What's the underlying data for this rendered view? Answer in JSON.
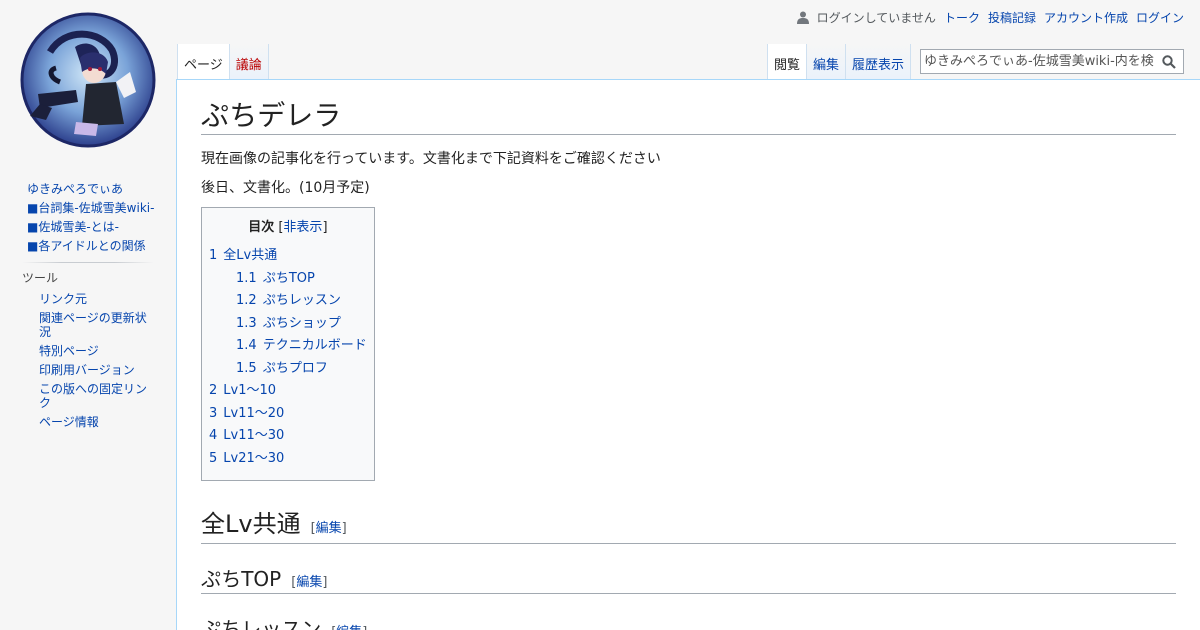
{
  "personal": {
    "anon_label": "ログインしていません",
    "talk": "トーク",
    "contributions": "投稿記録",
    "create_account": "アカウント作成",
    "login": "ログイン"
  },
  "sidebar": {
    "nav": [
      "ゆきみぺろでぃあ",
      "■台詞集-佐城雪美wiki-",
      "■佐城雪美-とは-",
      "■各アイドルとの関係"
    ],
    "tools_heading": "ツール",
    "tools": [
      "リンク元",
      "関連ページの更新状況",
      "特別ページ",
      "印刷用バージョン",
      "この版への固定リンク",
      "ページ情報"
    ]
  },
  "tabs": {
    "page": "ページ",
    "discussion": "議論",
    "read": "閲覧",
    "edit": "編集",
    "history": "履歴表示"
  },
  "search": {
    "placeholder": "ゆきみぺろでぃあ-佐城雪美wiki-内を検"
  },
  "article": {
    "title": "ぷちデレラ",
    "para1": "現在画像の記事化を行っています。文書化まで下記資料をご確認ください",
    "para2": "後日、文書化。(10月予定)"
  },
  "toc": {
    "title": "目次",
    "toggle_open": "[",
    "toggle": "非表示",
    "toggle_close": "]",
    "items": [
      {
        "num": "1",
        "text": "全Lv共通",
        "sub": false
      },
      {
        "num": "1.1",
        "text": "ぷちTOP",
        "sub": true
      },
      {
        "num": "1.2",
        "text": "ぷちレッスン",
        "sub": true
      },
      {
        "num": "1.3",
        "text": "ぷちショップ",
        "sub": true
      },
      {
        "num": "1.4",
        "text": "テクニカルボード",
        "sub": true
      },
      {
        "num": "1.5",
        "text": "ぷちプロフ",
        "sub": true
      },
      {
        "num": "2",
        "text": "Lv1～10",
        "sub": false
      },
      {
        "num": "3",
        "text": "Lv11～20",
        "sub": false
      },
      {
        "num": "4",
        "text": "Lv11～30",
        "sub": false
      },
      {
        "num": "5",
        "text": "Lv21～30",
        "sub": false
      }
    ]
  },
  "sections": {
    "s1": "全Lv共通",
    "s1_1": "ぷちTOP",
    "s1_2": "ぷちレッスン",
    "edit_open": "[",
    "edit_label": "編集",
    "edit_close": "]"
  }
}
